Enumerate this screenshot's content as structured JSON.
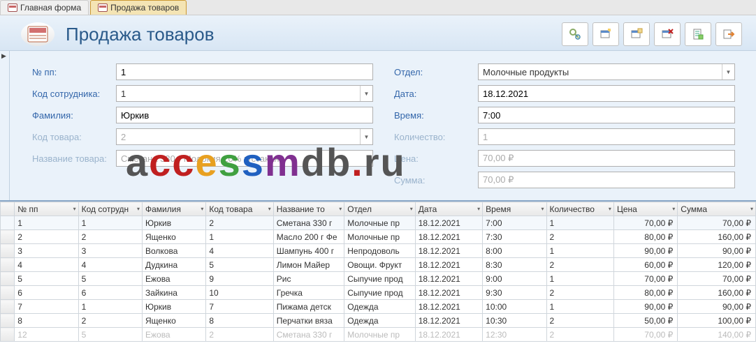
{
  "tabs": [
    {
      "label": "Главная форма"
    },
    {
      "label": "Продажа товаров"
    }
  ],
  "header": {
    "title": "Продажа товаров"
  },
  "fields_left": {
    "no_pp": {
      "label": "№ пп:",
      "value": "1"
    },
    "emp_code": {
      "label": "Код сотрудника:",
      "value": "1"
    },
    "surname": {
      "label": "Фамилия:",
      "value": "Юркив"
    },
    "item_code": {
      "label": "Код товара:",
      "value": "2"
    },
    "item_name": {
      "label": "Название товара:",
      "value": "Сметана 330 г Молокия 20% п/стакан"
    }
  },
  "fields_right": {
    "dept": {
      "label": "Отдел:",
      "value": "Молочные продукты"
    },
    "date": {
      "label": "Дата:",
      "value": "18.12.2021"
    },
    "time": {
      "label": "Время:",
      "value": "7:00"
    },
    "qty": {
      "label": "Количество:",
      "value": "1"
    },
    "price": {
      "label": "Цена:",
      "value": "70,00 ₽"
    },
    "sum": {
      "label": "Сумма:",
      "value": "70,00 ₽"
    }
  },
  "grid": {
    "columns": [
      "№ пп",
      "Код сотрудн",
      "Фамилия",
      "Код товара",
      "Название то",
      "Отдел",
      "Дата",
      "Время",
      "Количество",
      "Цена",
      "Сумма"
    ],
    "rows": [
      [
        "1",
        "1",
        "Юркив",
        "2",
        "Сметана 330 г",
        "Молочные пр",
        "18.12.2021",
        "7:00",
        "1",
        "70,00 ₽",
        "70,00 ₽"
      ],
      [
        "2",
        "2",
        "Ященко",
        "1",
        "Масло 200 г Фе",
        "Молочные пр",
        "18.12.2021",
        "7:30",
        "2",
        "80,00 ₽",
        "160,00 ₽"
      ],
      [
        "3",
        "3",
        "Волкова",
        "4",
        "Шампунь 400 г",
        "Непродоволь",
        "18.12.2021",
        "8:00",
        "1",
        "90,00 ₽",
        "90,00 ₽"
      ],
      [
        "4",
        "4",
        "Дудкина",
        "5",
        "Лимон Майер",
        "Овощи. Фрукт",
        "18.12.2021",
        "8:30",
        "2",
        "60,00 ₽",
        "120,00 ₽"
      ],
      [
        "5",
        "5",
        "Ежова",
        "9",
        "Рис",
        "Сыпучие прод",
        "18.12.2021",
        "9:00",
        "1",
        "70,00 ₽",
        "70,00 ₽"
      ],
      [
        "6",
        "6",
        "Зайкина",
        "10",
        "Гречка",
        "Сыпучие прод",
        "18.12.2021",
        "9:30",
        "2",
        "80,00 ₽",
        "160,00 ₽"
      ],
      [
        "7",
        "1",
        "Юркив",
        "7",
        "Пижама детск",
        "Одежда",
        "18.12.2021",
        "10:00",
        "1",
        "90,00 ₽",
        "90,00 ₽"
      ],
      [
        "8",
        "2",
        "Ященко",
        "8",
        "Перчатки вяза",
        "Одежда",
        "18.12.2021",
        "10:30",
        "2",
        "50,00 ₽",
        "100,00 ₽"
      ],
      [
        "12",
        "5",
        "Ежова",
        "2",
        "Сметана 330 г",
        "Молочные пр",
        "18.12.2021",
        "12:30",
        "2",
        "70,00 ₽",
        "140,00 ₽"
      ]
    ]
  },
  "watermark": "accessmdb.ru"
}
